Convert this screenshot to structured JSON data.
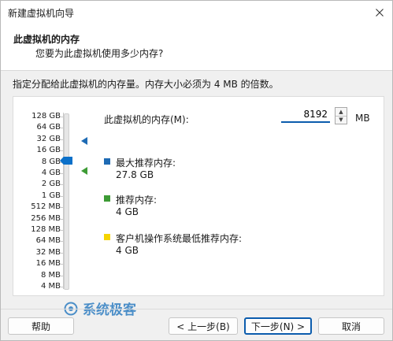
{
  "window": {
    "title": "新建虚拟机向导"
  },
  "header": {
    "title": "此虚拟机的内存",
    "subtitle": "您要为此虚拟机使用多少内存?"
  },
  "instruction": "指定分配给此虚拟机的内存量。内存大小必须为 4 MB 的倍数。",
  "memory_scale": [
    "128 GB",
    "64 GB",
    "32 GB",
    "16 GB",
    "8 GB",
    "4 GB",
    "2 GB",
    "1 GB",
    "512 MB",
    "256 MB",
    "128 MB",
    "64 MB",
    "32 MB",
    "16 MB",
    "8 MB",
    "4 MB"
  ],
  "memory": {
    "label": "此虚拟机的内存(M):",
    "value": "8192",
    "unit": "MB"
  },
  "legend": {
    "max": {
      "title": "最大推荐内存:",
      "value": "27.8 GB",
      "color": "#1e6bb4"
    },
    "recommended": {
      "title": "推荐内存:",
      "value": "4 GB",
      "color": "#3d9b35"
    },
    "guest_min": {
      "title": "客户机操作系统最低推荐内存:",
      "value": "4 GB",
      "color": "#f5d400"
    }
  },
  "watermark": "系统极客",
  "buttons": {
    "help": "帮助",
    "back": "< 上一步(B)",
    "next": "下一步(N) >",
    "cancel": "取消"
  },
  "colors": {
    "accent": "#0b5cad",
    "window_bg": "#f0f0f0"
  }
}
